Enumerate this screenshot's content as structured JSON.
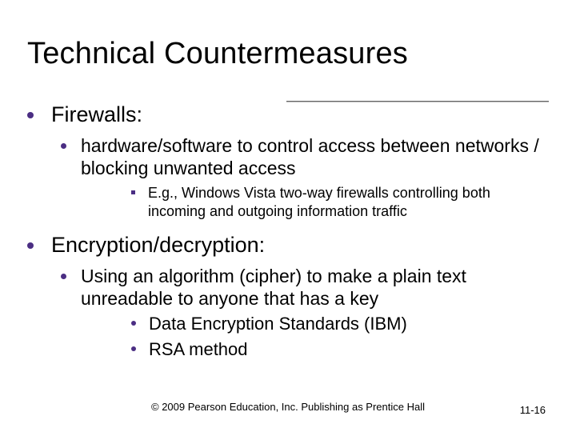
{
  "title": "Technical Countermeasures",
  "sections": [
    {
      "heading": "Firewalls:",
      "items": [
        {
          "text": "hardware/software to control access between networks / blocking unwanted access",
          "subitems_square": [
            "E.g., Windows Vista two-way firewalls controlling both incoming and outgoing information traffic"
          ]
        }
      ]
    },
    {
      "heading": "Encryption/decryption:",
      "items": [
        {
          "text": "Using an algorithm (cipher) to make a plain text unreadable to anyone that has a key",
          "subitems_round": [
            "Data Encryption Standards (IBM)",
            "RSA method"
          ]
        }
      ]
    }
  ],
  "footer": {
    "copyright": "© 2009 Pearson Education, Inc. Publishing as Prentice Hall",
    "page_number": "11-16"
  }
}
